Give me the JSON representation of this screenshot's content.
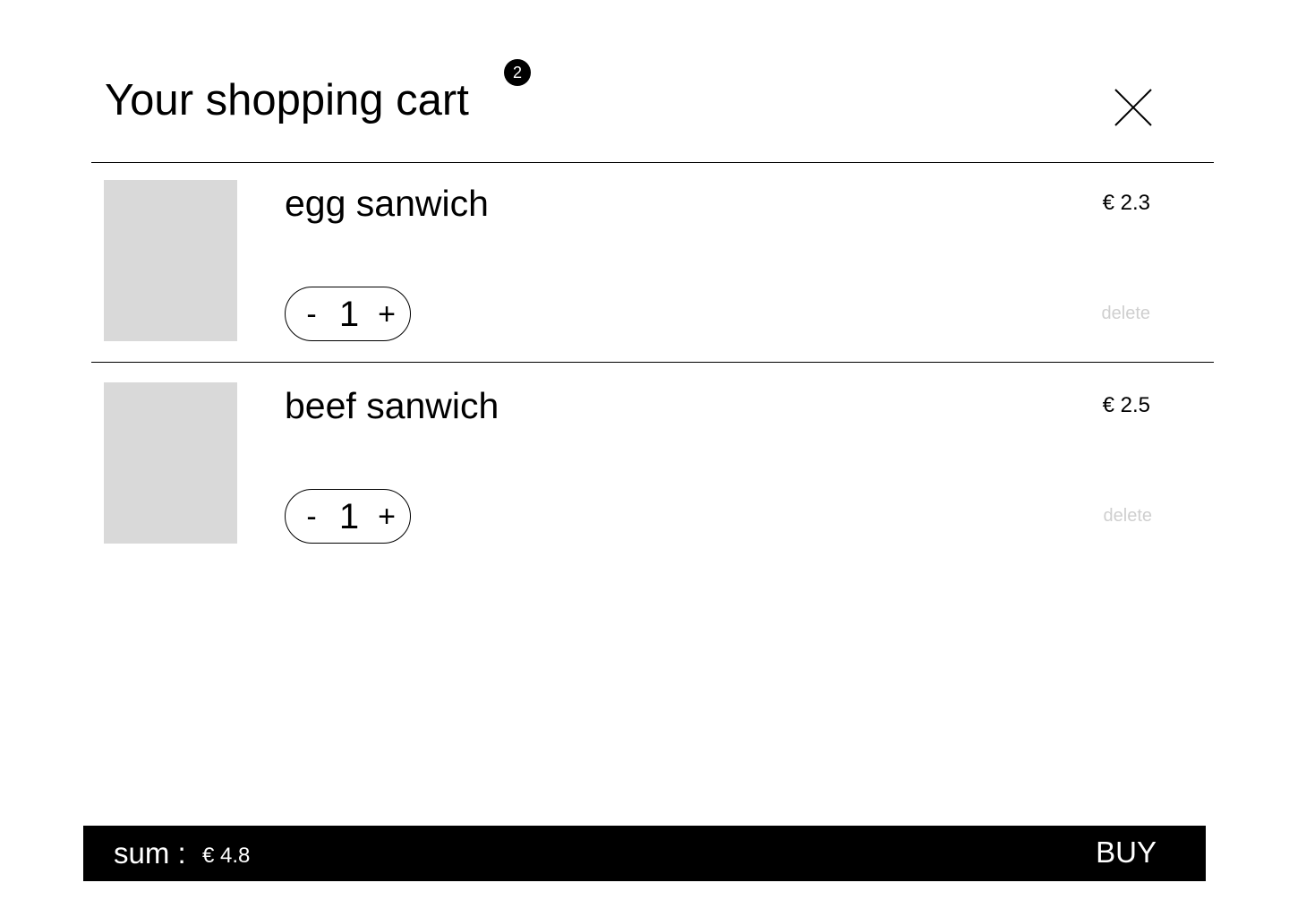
{
  "header": {
    "title": "Your shopping cart",
    "badge_count": "2",
    "close_icon": "close-icon"
  },
  "items": [
    {
      "name": "egg sanwich",
      "price": "€ 2.3",
      "minus": "-",
      "quantity": "1",
      "plus": "+",
      "delete_label": "delete"
    },
    {
      "name": "beef sanwich",
      "price": "€ 2.5",
      "minus": "-",
      "quantity": "1",
      "plus": "+",
      "delete_label": "delete"
    }
  ],
  "footer": {
    "sum_label": "sum :",
    "sum_value": "€ 4.8",
    "buy_label": "BUY"
  },
  "colors": {
    "text": "#000000",
    "background": "#ffffff",
    "thumbnail": "#d9d9d9",
    "delete_text": "#cfcfcf",
    "footer_bg": "#000000",
    "footer_text": "#ffffff"
  }
}
